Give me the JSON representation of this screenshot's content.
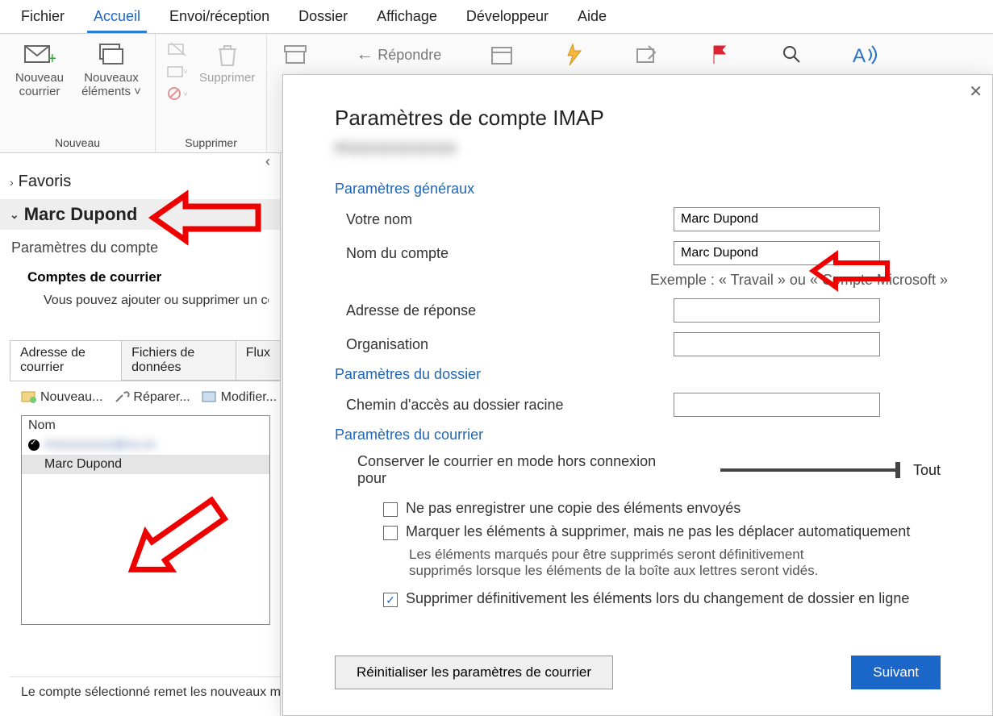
{
  "ribbon_tabs": {
    "fichier": "Fichier",
    "accueil": "Accueil",
    "envoi": "Envoi/réception",
    "dossier": "Dossier",
    "affichage": "Affichage",
    "dev": "Développeur",
    "aide": "Aide"
  },
  "ribbon": {
    "nouveau_courrier": "Nouveau courrier",
    "nouveaux_elements": "Nouveaux éléments",
    "group_nouveau": "Nouveau",
    "supprimer": "Supprimer",
    "group_supprimer": "Supprimer",
    "repondre": "Répondre"
  },
  "nav": {
    "favoris": "Favoris",
    "account_name": "Marc Dupond"
  },
  "settings": {
    "title": "Paramètres du compte",
    "subtitle": "Comptes de courrier",
    "desc": "Vous pouvez ajouter ou supprimer un co"
  },
  "subtabs": {
    "adresse": "Adresse de courrier",
    "fichiers": "Fichiers de données",
    "flux": "Flux"
  },
  "toolbar": {
    "nouveau": "Nouveau...",
    "reparer": "Réparer...",
    "modifier": "Modifier..."
  },
  "list": {
    "header": "Nom",
    "row_blur": "mxxxxxxxxx@xx.xx",
    "row2": "Marc Dupond"
  },
  "bottom_note": "Le compte sélectionné remet les nouveaux me",
  "dlg": {
    "title": "Paramètres de compte IMAP",
    "blur": "mxxxxxxxxxxx",
    "sec_general": "Paramètres généraux",
    "your_name_label": "Votre nom",
    "your_name_value": "Marc Dupond",
    "acct_name_label": "Nom du compte",
    "acct_name_value": "Marc Dupond",
    "example": "Exemple : « Travail » ou « Compte Microsoft »",
    "reply_label": "Adresse de réponse",
    "reply_value": "",
    "org_label": "Organisation",
    "org_value": "",
    "sec_folder": "Paramètres du dossier",
    "root_label": "Chemin d'accès au dossier racine",
    "root_value": "",
    "sec_mail": "Paramètres du courrier",
    "offline_label": "Conserver le courrier en mode hors connexion pour",
    "offline_value": "Tout",
    "cb1": "Ne pas enregistrer une copie des éléments envoyés",
    "cb2": "Marquer les éléments à supprimer, mais ne pas les déplacer automatiquement",
    "cb2_note": "Les éléments marqués pour être supprimés seront définitivement supprimés lorsque les éléments de la boîte aux lettres seront vidés.",
    "cb3": "Supprimer définitivement les éléments lors du changement de dossier en ligne",
    "reset_btn": "Réinitialiser les paramètres de courrier",
    "next_btn": "Suivant"
  }
}
